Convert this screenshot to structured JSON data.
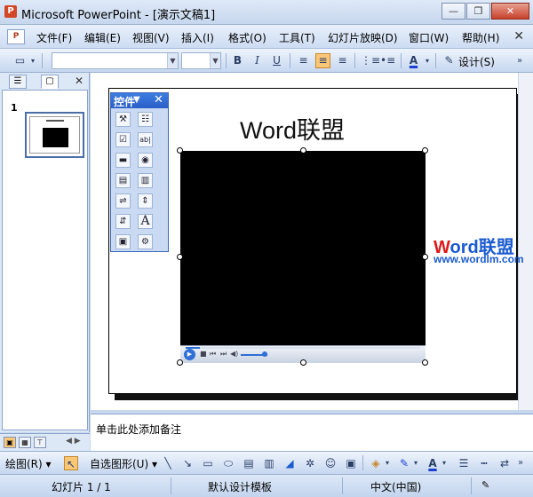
{
  "window": {
    "title": "Microsoft PowerPoint - [演示文稿1]",
    "buttons": {
      "minimize": "—",
      "restore": "❐",
      "close": "✕"
    }
  },
  "menubar": {
    "items": [
      "文件(F)",
      "编辑(E)",
      "视图(V)",
      "插入(I)",
      "格式(O)",
      "工具(T)",
      "幻灯片放映(D)",
      "窗口(W)",
      "帮助(H)"
    ],
    "close_symbol": "✕"
  },
  "toolbar": {
    "font_name_value": "",
    "font_size_value": "",
    "bold": "B",
    "italic": "I",
    "underline": "U",
    "design_label": "设计(S)",
    "font_color_letter": "A",
    "alignment_active": "center"
  },
  "left_panel": {
    "close_symbol": "✕",
    "slides": [
      {
        "number": "1"
      }
    ]
  },
  "slide": {
    "title": "Word联盟",
    "media": {
      "type": "video-player",
      "state": "stopped"
    }
  },
  "control_toolbox": {
    "title": "控件",
    "dropdown_symbol": "▼",
    "close_symbol": "✕",
    "items": [
      "command-button",
      "image-button",
      "checkbox",
      "textbox",
      "toggle-button",
      "option-button",
      "listbox",
      "combobox",
      "scrollbar",
      "spinner",
      "label",
      "label-A",
      "image",
      "more-controls"
    ]
  },
  "watermark": {
    "brand_w": "W",
    "brand_rest": "ord联盟",
    "url": "www.wordlm.com"
  },
  "notes": {
    "placeholder": "单击此处添加备注"
  },
  "drawing_toolbar": {
    "draw_label": "绘图(R)",
    "autoshapes_label": "自选图形(U)"
  },
  "statusbar": {
    "slide_info": "幻灯片 1 / 1",
    "template": "默认设计模板",
    "language": "中文(中国)"
  }
}
